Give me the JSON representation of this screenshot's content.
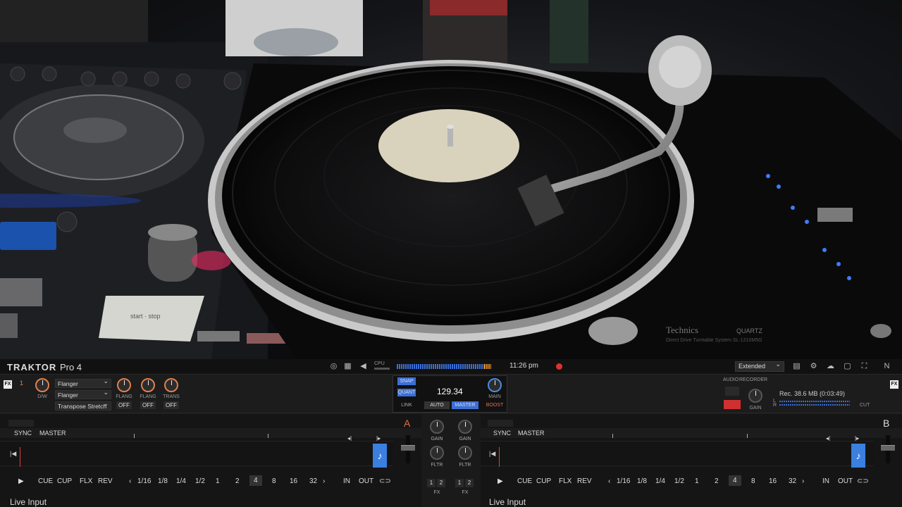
{
  "app": {
    "name_bold": "TRAKTOR",
    "name_light": "Pro 4"
  },
  "topbar": {
    "cpu_label": "CPU",
    "clock": "11:26 pm",
    "layout": "Extended"
  },
  "fx_left": {
    "tag": "FX",
    "unit": "1",
    "dw_label": "D/W",
    "slots": [
      "Flanger",
      "Flanger",
      "Transpose Stretch"
    ],
    "knob_labels": [
      "FLANG",
      "FLANG",
      "TRANS"
    ],
    "buttons": [
      "OFF",
      "OFF",
      "OFF"
    ]
  },
  "fx_right": {
    "tag": "FX"
  },
  "master": {
    "snap": "SNAP",
    "quant": "QUANT",
    "link": "LINK",
    "bpm": "129.34",
    "auto": "AUTO",
    "master": "MASTER",
    "main": "MAIN",
    "boost": "BOOST"
  },
  "recorder": {
    "audio": "AUDIO",
    "rec_title": "RECORDER",
    "gain": "GAIN",
    "info": "Rec. 38.6 MB (0:03:49)",
    "l": "L",
    "r": "R",
    "cut": "CUT"
  },
  "deck_a": {
    "letter": "A",
    "sync": "SYNC",
    "master": "MASTER",
    "transport": [
      "CUE",
      "CUP",
      "FLX",
      "REV"
    ],
    "loops": [
      "1/16",
      "1/8",
      "1/4",
      "1/2",
      "1",
      "2",
      "4",
      "8",
      "16",
      "32"
    ],
    "selected_loop": "4",
    "in": "IN",
    "out": "OUT",
    "source": "Live Input"
  },
  "deck_b": {
    "letter": "B",
    "sync": "SYNC",
    "master": "MASTER",
    "transport": [
      "CUE",
      "CUP",
      "FLX",
      "REV"
    ],
    "loops": [
      "1/16",
      "1/8",
      "1/4",
      "1/2",
      "1",
      "2",
      "4",
      "8",
      "16",
      "32"
    ],
    "selected_loop": "4",
    "in": "IN",
    "out": "OUT",
    "source": "Live Input"
  },
  "mixer": {
    "gain": "GAIN",
    "fltr": "FLTR",
    "fx": "FX",
    "one": "1",
    "two": "2"
  },
  "photo": {
    "button_label": "start · stop",
    "turntable_brand": "Technics",
    "turntable_mark": "QUARTZ",
    "turntable_caption": "Direct Drive Turntable System SL-1210M5G"
  },
  "colors": {
    "accent_blue": "#3b6fd8",
    "accent_orange": "#e0804a",
    "rec_red": "#e03030"
  }
}
